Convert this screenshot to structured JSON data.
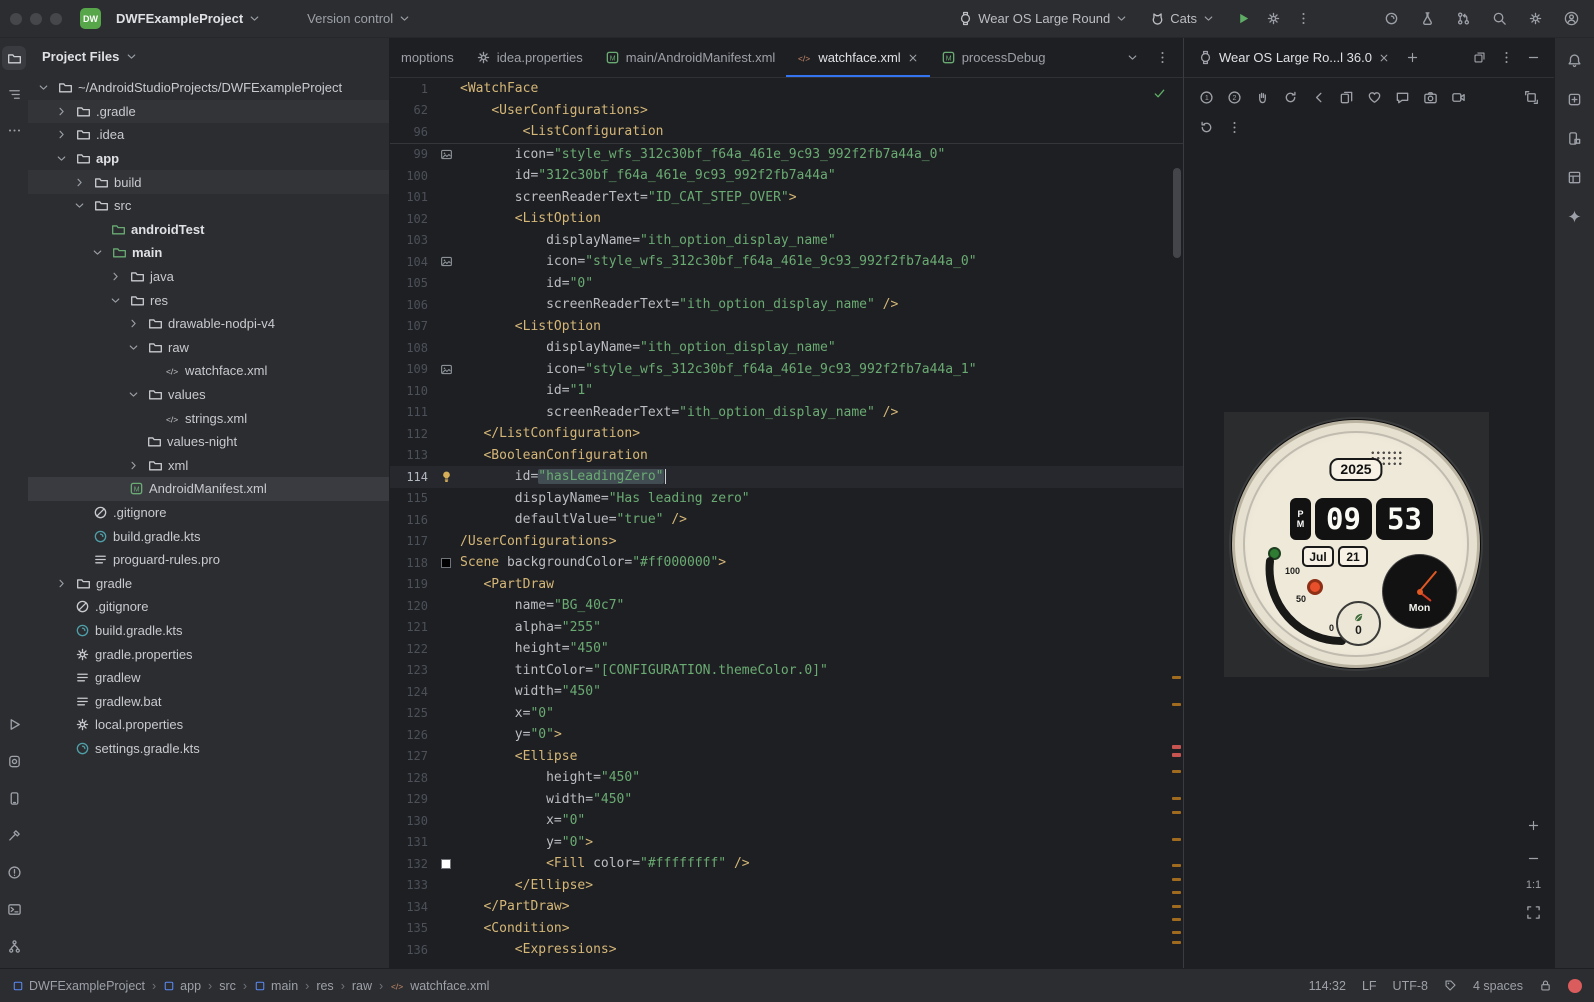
{
  "titlebar": {
    "logo": "DW",
    "project_name": "DWFExampleProject",
    "version_control_label": "Version control",
    "device_selector_label": "Wear OS Large Round",
    "run_config_label": "Cats",
    "run_controls": [
      "run",
      "profiler-gear",
      "more-v"
    ],
    "right_icons": [
      "gradle-sync",
      "ai-assistant",
      "pull-request",
      "search",
      "settings",
      "avatar"
    ]
  },
  "left_strip": {
    "top_items": [
      "project-folder",
      "structure",
      "more-h"
    ],
    "bottom_items": [
      "run-outline",
      "running-devices",
      "device-manager",
      "build",
      "problems",
      "terminal",
      "version-control"
    ]
  },
  "right_strip": {
    "items": [
      "notifications",
      "assistant",
      "device-explorer",
      "layout-inspector",
      "gemini"
    ]
  },
  "project_panel": {
    "title": "Project Files",
    "tree": [
      {
        "label": "~/AndroidStudioProjects/DWFExampleProject",
        "indent": 0,
        "chevron": "down",
        "icon": "folder"
      },
      {
        "label": ".gradle",
        "indent": 1,
        "chevron": "right",
        "icon": "folder",
        "state": "subtle"
      },
      {
        "label": ".idea",
        "indent": 1,
        "chevron": "right",
        "icon": "folder"
      },
      {
        "label": "app",
        "indent": 1,
        "chevron": "down",
        "icon": "folder",
        "bold": true
      },
      {
        "label": "build",
        "indent": 2,
        "chevron": "right",
        "icon": "folder",
        "state": "subtle"
      },
      {
        "label": "src",
        "indent": 2,
        "chevron": "down",
        "icon": "folder"
      },
      {
        "label": "androidTest",
        "indent": 3,
        "chevron": "none",
        "icon": "folder-green",
        "bold": true
      },
      {
        "label": "main",
        "indent": 3,
        "chevron": "down",
        "icon": "folder-green",
        "bold": true
      },
      {
        "label": "java",
        "indent": 4,
        "chevron": "right",
        "icon": "folder"
      },
      {
        "label": "res",
        "indent": 4,
        "chevron": "down",
        "icon": "folder"
      },
      {
        "label": "drawable-nodpi-v4",
        "indent": 5,
        "chevron": "right",
        "icon": "folder"
      },
      {
        "label": "raw",
        "indent": 5,
        "chevron": "down",
        "icon": "folder"
      },
      {
        "label": "watchface.xml",
        "indent": 6,
        "chevron": "none",
        "icon": "xml-file"
      },
      {
        "label": "values",
        "indent": 5,
        "chevron": "down",
        "icon": "folder"
      },
      {
        "label": "strings.xml",
        "indent": 6,
        "chevron": "none",
        "icon": "xml-file"
      },
      {
        "label": "values-night",
        "indent": 5,
        "chevron": "none",
        "icon": "folder"
      },
      {
        "label": "xml",
        "indent": 5,
        "chevron": "right",
        "icon": "folder"
      },
      {
        "label": "AndroidManifest.xml",
        "indent": 4,
        "chevron": "none",
        "icon": "manifest-file",
        "state": "selected"
      },
      {
        "label": ".gitignore",
        "indent": 2,
        "chevron": "none",
        "icon": "ignored-file"
      },
      {
        "label": "build.gradle.kts",
        "indent": 2,
        "chevron": "none",
        "icon": "gradle-file"
      },
      {
        "label": "proguard-rules.pro",
        "indent": 2,
        "chevron": "none",
        "icon": "text-file"
      },
      {
        "label": "gradle",
        "indent": 1,
        "chevron": "right",
        "icon": "folder"
      },
      {
        "label": ".gitignore",
        "indent": 1,
        "chevron": "none",
        "icon": "ignored-file"
      },
      {
        "label": "build.gradle.kts",
        "indent": 1,
        "chevron": "none",
        "icon": "gradle-file"
      },
      {
        "label": "gradle.properties",
        "indent": 1,
        "chevron": "none",
        "icon": "props-file"
      },
      {
        "label": "gradlew",
        "indent": 1,
        "chevron": "none",
        "icon": "text-file"
      },
      {
        "label": "gradlew.bat",
        "indent": 1,
        "chevron": "none",
        "icon": "text-file"
      },
      {
        "label": "local.properties",
        "indent": 1,
        "chevron": "none",
        "icon": "props-file"
      },
      {
        "label": "settings.gradle.kts",
        "indent": 1,
        "chevron": "none",
        "icon": "gradle-file"
      }
    ]
  },
  "editor": {
    "tabs": [
      {
        "label": "moptions"
      },
      {
        "label": "idea.properties",
        "icon": "props-file"
      },
      {
        "label": "main/AndroidManifest.xml",
        "icon": "manifest-file"
      },
      {
        "label": "watchface.xml",
        "icon": "xml-file",
        "active": true,
        "closable": true
      },
      {
        "label": "processDebug",
        "icon": "manifest-green"
      }
    ],
    "tab_controls": [
      "chevron-down",
      "more-v"
    ],
    "sticky": [
      {
        "n": 1,
        "s": [
          [
            "tg",
            "<WatchFace"
          ]
        ]
      },
      {
        "n": 62,
        "s": [
          [
            "pl",
            "    "
          ],
          [
            "tg",
            "<UserConfigurations>"
          ]
        ]
      },
      {
        "n": 96,
        "s": [
          [
            "pl",
            "        "
          ],
          [
            "tg",
            "<ListConfiguration"
          ]
        ]
      }
    ],
    "lines": [
      {
        "n": 99,
        "g": "image",
        "s": [
          [
            "pl",
            "       "
          ],
          [
            "at",
            "icon"
          ],
          [
            "pl",
            "="
          ],
          [
            "vl",
            "\"style_wfs_312c30bf_f64a_461e_9c93_992f2fb7a44a_0\""
          ]
        ]
      },
      {
        "n": 100,
        "s": [
          [
            "pl",
            "       "
          ],
          [
            "at",
            "id"
          ],
          [
            "pl",
            "="
          ],
          [
            "vl",
            "\"312c30bf_f64a_461e_9c93_992f2fb7a44a\""
          ]
        ]
      },
      {
        "n": 101,
        "s": [
          [
            "pl",
            "       "
          ],
          [
            "at",
            "screenReaderText"
          ],
          [
            "pl",
            "="
          ],
          [
            "vl",
            "\"ID_CAT_STEP_OVER\""
          ],
          [
            "tg",
            ">"
          ]
        ]
      },
      {
        "n": 102,
        "s": [
          [
            "pl",
            "       "
          ],
          [
            "tg",
            "<ListOption"
          ]
        ]
      },
      {
        "n": 103,
        "s": [
          [
            "pl",
            "           "
          ],
          [
            "at",
            "displayName"
          ],
          [
            "pl",
            "="
          ],
          [
            "vl",
            "\"ith_option_display_name\""
          ]
        ]
      },
      {
        "n": 104,
        "g": "image",
        "s": [
          [
            "pl",
            "           "
          ],
          [
            "at",
            "icon"
          ],
          [
            "pl",
            "="
          ],
          [
            "vl",
            "\"style_wfs_312c30bf_f64a_461e_9c93_992f2fb7a44a_0\""
          ]
        ]
      },
      {
        "n": 105,
        "s": [
          [
            "pl",
            "           "
          ],
          [
            "at",
            "id"
          ],
          [
            "pl",
            "="
          ],
          [
            "vl",
            "\"0\""
          ]
        ]
      },
      {
        "n": 106,
        "s": [
          [
            "pl",
            "           "
          ],
          [
            "at",
            "screenReaderText"
          ],
          [
            "pl",
            "="
          ],
          [
            "vl",
            "\"ith_option_display_name\""
          ],
          [
            "pl",
            " "
          ],
          [
            "tg",
            "/>"
          ]
        ]
      },
      {
        "n": 107,
        "s": [
          [
            "pl",
            "       "
          ],
          [
            "tg",
            "<ListOption"
          ]
        ]
      },
      {
        "n": 108,
        "s": [
          [
            "pl",
            "           "
          ],
          [
            "at",
            "displayName"
          ],
          [
            "pl",
            "="
          ],
          [
            "vl",
            "\"ith_option_display_name\""
          ]
        ]
      },
      {
        "n": 109,
        "g": "image",
        "s": [
          [
            "pl",
            "           "
          ],
          [
            "at",
            "icon"
          ],
          [
            "pl",
            "="
          ],
          [
            "vl",
            "\"style_wfs_312c30bf_f64a_461e_9c93_992f2fb7a44a_1\""
          ]
        ]
      },
      {
        "n": 110,
        "s": [
          [
            "pl",
            "           "
          ],
          [
            "at",
            "id"
          ],
          [
            "pl",
            "="
          ],
          [
            "vl",
            "\"1\""
          ]
        ]
      },
      {
        "n": 111,
        "s": [
          [
            "pl",
            "           "
          ],
          [
            "at",
            "screenReaderText"
          ],
          [
            "pl",
            "="
          ],
          [
            "vl",
            "\"ith_option_display_name\""
          ],
          [
            "pl",
            " "
          ],
          [
            "tg",
            "/>"
          ]
        ]
      },
      {
        "n": 112,
        "s": [
          [
            "pl",
            "   "
          ],
          [
            "tg",
            "</ListConfiguration>"
          ]
        ]
      },
      {
        "n": 113,
        "s": [
          [
            "pl",
            "   "
          ],
          [
            "tg",
            "<BooleanConfiguration"
          ]
        ]
      },
      {
        "n": 114,
        "g": "bulb",
        "hl": true,
        "s": [
          [
            "pl",
            "       "
          ],
          [
            "at",
            "id"
          ],
          [
            "pl",
            "="
          ],
          [
            "vh",
            "\"hasLeadingZero\""
          ],
          [
            "cr",
            ""
          ]
        ]
      },
      {
        "n": 115,
        "s": [
          [
            "pl",
            "       "
          ],
          [
            "at",
            "displayName"
          ],
          [
            "pl",
            "="
          ],
          [
            "vl",
            "\"Has leading zero\""
          ]
        ]
      },
      {
        "n": 116,
        "s": [
          [
            "pl",
            "       "
          ],
          [
            "at",
            "defaultValue"
          ],
          [
            "pl",
            "="
          ],
          [
            "vl",
            "\"true\""
          ],
          [
            "pl",
            " "
          ],
          [
            "tg",
            "/>"
          ]
        ]
      },
      {
        "n": 117,
        "s": [
          [
            "tg",
            "/UserConfigurations>"
          ]
        ]
      },
      {
        "n": 118,
        "g": "swb",
        "s": [
          [
            "tg",
            "Scene"
          ],
          [
            "pl",
            " "
          ],
          [
            "at",
            "backgroundColor"
          ],
          [
            "pl",
            "="
          ],
          [
            "vl",
            "\"#ff000000\""
          ],
          [
            "tg",
            ">"
          ]
        ]
      },
      {
        "n": 119,
        "s": [
          [
            "pl",
            "   "
          ],
          [
            "tg",
            "<PartDraw"
          ]
        ]
      },
      {
        "n": 120,
        "s": [
          [
            "pl",
            "       "
          ],
          [
            "at",
            "name"
          ],
          [
            "pl",
            "="
          ],
          [
            "vl",
            "\"BG_40c7\""
          ]
        ]
      },
      {
        "n": 121,
        "s": [
          [
            "pl",
            "       "
          ],
          [
            "at",
            "alpha"
          ],
          [
            "pl",
            "="
          ],
          [
            "vl",
            "\"255\""
          ]
        ]
      },
      {
        "n": 122,
        "s": [
          [
            "pl",
            "       "
          ],
          [
            "at",
            "height"
          ],
          [
            "pl",
            "="
          ],
          [
            "vl",
            "\"450\""
          ]
        ]
      },
      {
        "n": 123,
        "s": [
          [
            "pl",
            "       "
          ],
          [
            "at",
            "tintColor"
          ],
          [
            "pl",
            "="
          ],
          [
            "vl",
            "\"[CONFIGURATION.themeColor.0]\""
          ]
        ]
      },
      {
        "n": 124,
        "s": [
          [
            "pl",
            "       "
          ],
          [
            "at",
            "width"
          ],
          [
            "pl",
            "="
          ],
          [
            "vl",
            "\"450\""
          ]
        ]
      },
      {
        "n": 125,
        "s": [
          [
            "pl",
            "       "
          ],
          [
            "at",
            "x"
          ],
          [
            "pl",
            "="
          ],
          [
            "vl",
            "\"0\""
          ]
        ]
      },
      {
        "n": 126,
        "s": [
          [
            "pl",
            "       "
          ],
          [
            "at",
            "y"
          ],
          [
            "pl",
            "="
          ],
          [
            "vl",
            "\"0\""
          ],
          [
            "tg",
            ">"
          ]
        ]
      },
      {
        "n": 127,
        "s": [
          [
            "pl",
            "       "
          ],
          [
            "tg",
            "<Ellipse"
          ]
        ]
      },
      {
        "n": 128,
        "s": [
          [
            "pl",
            "           "
          ],
          [
            "at",
            "height"
          ],
          [
            "pl",
            "="
          ],
          [
            "vl",
            "\"450\""
          ]
        ]
      },
      {
        "n": 129,
        "s": [
          [
            "pl",
            "           "
          ],
          [
            "at",
            "width"
          ],
          [
            "pl",
            "="
          ],
          [
            "vl",
            "\"450\""
          ]
        ]
      },
      {
        "n": 130,
        "s": [
          [
            "pl",
            "           "
          ],
          [
            "at",
            "x"
          ],
          [
            "pl",
            "="
          ],
          [
            "vl",
            "\"0\""
          ]
        ]
      },
      {
        "n": 131,
        "s": [
          [
            "pl",
            "           "
          ],
          [
            "at",
            "y"
          ],
          [
            "pl",
            "="
          ],
          [
            "vl",
            "\"0\""
          ],
          [
            "tg",
            ">"
          ]
        ]
      },
      {
        "n": 132,
        "g": "sww",
        "s": [
          [
            "pl",
            "           "
          ],
          [
            "tg",
            "<Fill"
          ],
          [
            "pl",
            " "
          ],
          [
            "at",
            "color"
          ],
          [
            "pl",
            "="
          ],
          [
            "vl",
            "\"#ffffffff\""
          ],
          [
            "pl",
            " "
          ],
          [
            "tg",
            "/>"
          ]
        ]
      },
      {
        "n": 133,
        "s": [
          [
            "pl",
            "       "
          ],
          [
            "tg",
            "</Ellipse>"
          ]
        ]
      },
      {
        "n": 134,
        "s": [
          [
            "pl",
            "   "
          ],
          [
            "tg",
            "</PartDraw>"
          ]
        ]
      },
      {
        "n": 135,
        "s": [
          [
            "pl",
            "   "
          ],
          [
            "tg",
            "<Condition>"
          ]
        ]
      },
      {
        "n": 136,
        "s": [
          [
            "pl",
            "       "
          ],
          [
            "tg",
            "<Expressions>"
          ]
        ]
      }
    ],
    "scroll_marks": [
      {
        "t": 638,
        "c": "o"
      },
      {
        "t": 665,
        "c": "o"
      },
      {
        "t": 707,
        "c": "r"
      },
      {
        "t": 715,
        "c": "r"
      },
      {
        "t": 732,
        "c": "o"
      },
      {
        "t": 759,
        "c": "o"
      },
      {
        "t": 773,
        "c": "o"
      },
      {
        "t": 800,
        "c": "o"
      },
      {
        "t": 826,
        "c": "o"
      },
      {
        "t": 840,
        "c": "o"
      },
      {
        "t": 853,
        "c": "o"
      },
      {
        "t": 867,
        "c": "o"
      },
      {
        "t": 880,
        "c": "o"
      },
      {
        "t": 893,
        "c": "o"
      },
      {
        "t": 903,
        "c": "o"
      }
    ]
  },
  "device_panel": {
    "tab_label": "Wear OS Large Ro...l 36.0",
    "header_icons": [
      "plus",
      "open-new",
      "more-v",
      "minimize"
    ],
    "toolbar_row1": [
      "button-1",
      "button-2",
      "palm",
      "tilt",
      "back",
      "app-switch",
      "heart",
      "message",
      "camera",
      "video"
    ],
    "toolbar_row1_right": [
      "snapshot"
    ],
    "toolbar_row2": [
      "reset",
      "more-v"
    ],
    "zoom_label": "1:1",
    "watch": {
      "year": "2025",
      "ampm_top": "P",
      "ampm_bottom": "M",
      "hour": "09",
      "minute": "53",
      "month": "Jul",
      "day": "21",
      "weekday": "Mon",
      "gauge_top": "100",
      "gauge_mid": "50",
      "gauge_bottom": "0",
      "badge_value": "0"
    }
  },
  "statusbar": {
    "breadcrumbs": [
      {
        "label": "DWFExampleProject",
        "icon": "module"
      },
      {
        "label": "app",
        "icon": "module"
      },
      {
        "label": "src"
      },
      {
        "label": "main",
        "icon": "module"
      },
      {
        "label": "res"
      },
      {
        "label": "raw"
      },
      {
        "label": "watchface.xml",
        "icon": "xml-file"
      }
    ],
    "caret_position": "114:32",
    "line_separator": "LF",
    "encoding": "UTF-8",
    "indent": "4 spaces"
  }
}
